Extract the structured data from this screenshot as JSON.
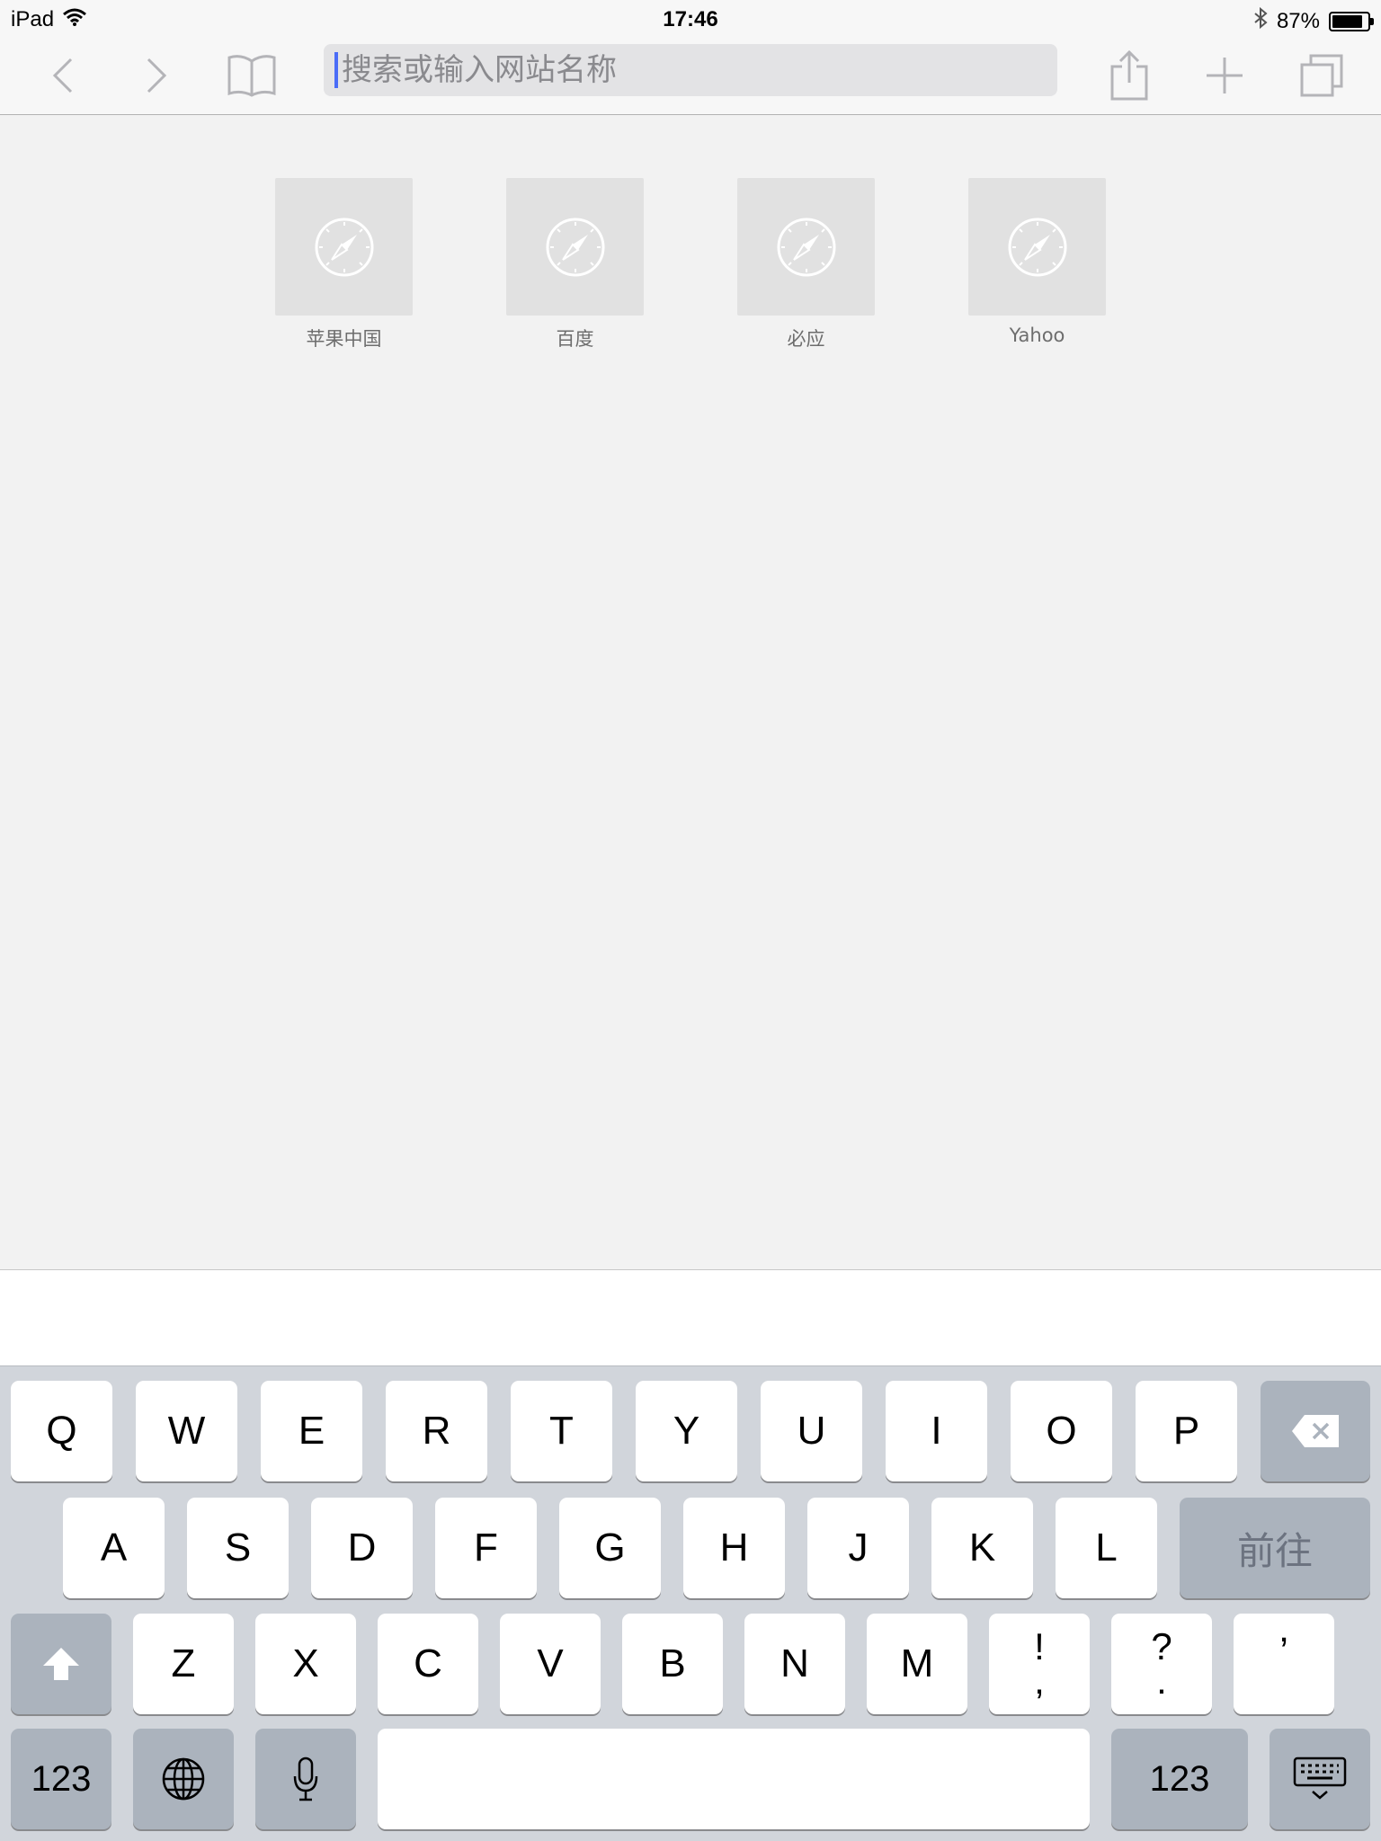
{
  "status_bar": {
    "device": "iPad",
    "time": "17:46",
    "battery_percent": "87%",
    "battery_level": 0.87
  },
  "toolbar": {
    "address_placeholder": "搜索或输入网站名称",
    "address_value": ""
  },
  "favorites": [
    {
      "label": "苹果中国",
      "icon": "compass-icon"
    },
    {
      "label": "百度",
      "icon": "compass-icon"
    },
    {
      "label": "必应",
      "icon": "compass-icon"
    },
    {
      "label": "Yahoo",
      "icon": "compass-icon"
    }
  ],
  "keyboard": {
    "row1": [
      "Q",
      "W",
      "E",
      "R",
      "T",
      "Y",
      "U",
      "I",
      "O",
      "P"
    ],
    "row2": [
      "A",
      "S",
      "D",
      "F",
      "G",
      "H",
      "J",
      "K",
      "L"
    ],
    "go_label": "前往",
    "row3": [
      "Z",
      "X",
      "C",
      "V",
      "B",
      "N",
      "M"
    ],
    "punct1_top": "!",
    "punct1_bottom": ",",
    "punct2_top": "?",
    "punct2_bottom": ".",
    "punct3": "’",
    "numbers_label": "123"
  },
  "colors": {
    "accent_caret": "#4a6cf7",
    "keyboard_bg": "#d1d5db",
    "key_dark": "#abb3bd"
  }
}
